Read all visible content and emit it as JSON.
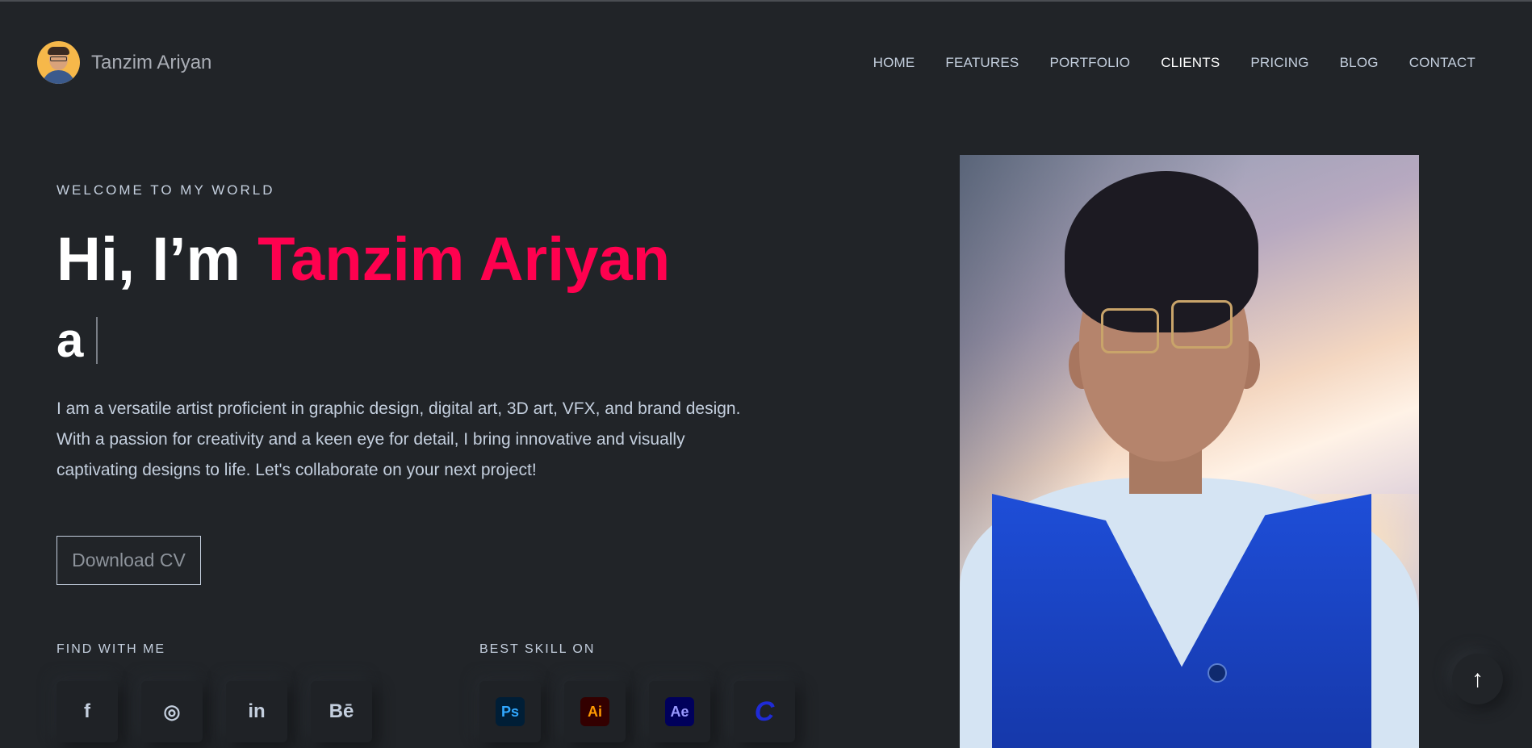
{
  "brand": {
    "name": "Tanzim Ariyan"
  },
  "nav": {
    "items": [
      {
        "label": "HOME"
      },
      {
        "label": "FEATURES"
      },
      {
        "label": "PORTFOLIO"
      },
      {
        "label": "CLIENTS"
      },
      {
        "label": "PRICING"
      },
      {
        "label": "BLOG"
      },
      {
        "label": "CONTACT"
      }
    ],
    "active": "CLIENTS"
  },
  "hero": {
    "welcome": "WELCOME TO MY WORLD",
    "greeting": "Hi, I’m ",
    "name": "Tanzim Ariyan",
    "typed_prefix": "a",
    "bio": "I am a versatile artist proficient in graphic design, digital art, 3D art, VFX, and brand design. With a passion for creativity and a keen eye for detail, I bring innovative and visually captivating designs to life. Let's collaborate on your next project!",
    "cv_button": "Download CV"
  },
  "find_with_me": {
    "title": "FIND WITH ME",
    "icons": [
      {
        "name": "facebook-icon",
        "glyph": "f"
      },
      {
        "name": "instagram-icon",
        "glyph": "◎"
      },
      {
        "name": "linkedin-icon",
        "glyph": "in"
      },
      {
        "name": "behance-icon",
        "glyph": "Bē"
      }
    ]
  },
  "best_skill_on": {
    "title": "BEST SKILL ON",
    "icons": [
      {
        "name": "photoshop-icon",
        "glyph": "Ps"
      },
      {
        "name": "illustrator-icon",
        "glyph": "Ai"
      },
      {
        "name": "after-effects-icon",
        "glyph": "Ae"
      },
      {
        "name": "canva-icon",
        "glyph": "C"
      }
    ]
  },
  "back_to_top": {
    "glyph": "↑"
  },
  "colors": {
    "background": "#212428",
    "accent": "#ff014f",
    "text": "#c4cfde",
    "heading": "#ffffff"
  }
}
